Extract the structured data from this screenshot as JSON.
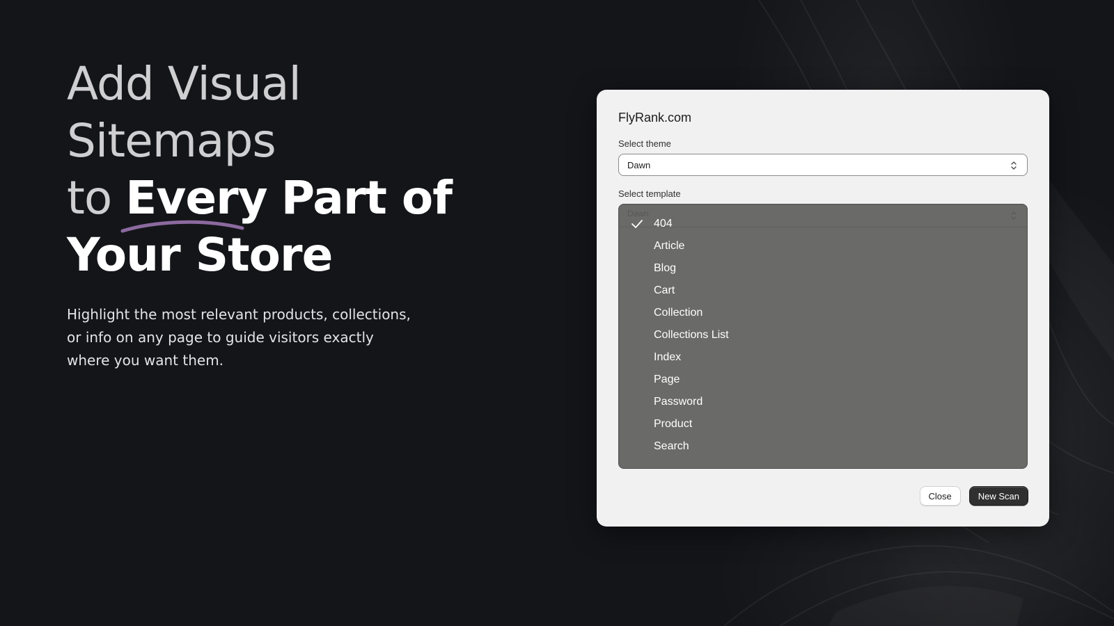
{
  "hero": {
    "headline_line1": "Add Visual Sitemaps",
    "headline_line2_prefix": "to",
    "headline_line2_emphasis": "Every",
    "headline_line2_suffix": "Part of",
    "headline_line3": "Your Store",
    "subtext": "Highlight the most relevant products, collections, or info on any page to guide visitors exactly where you want them.",
    "underline_color": "#8b6a9f"
  },
  "dialog": {
    "title": "FlyRank.com",
    "theme_label": "Select theme",
    "theme_value": "Dawn",
    "template_label": "Select template",
    "template_ghost_value": "Dawn",
    "template_options": [
      {
        "label": "404",
        "selected": true
      },
      {
        "label": "Article",
        "selected": false
      },
      {
        "label": "Blog",
        "selected": false
      },
      {
        "label": "Cart",
        "selected": false
      },
      {
        "label": "Collection",
        "selected": false
      },
      {
        "label": "Collections List",
        "selected": false
      },
      {
        "label": "Index",
        "selected": false
      },
      {
        "label": "Page",
        "selected": false
      },
      {
        "label": "Password",
        "selected": false
      },
      {
        "label": "Product",
        "selected": false
      },
      {
        "label": "Search",
        "selected": false
      }
    ],
    "close_label": "Close",
    "new_scan_label": "New Scan"
  },
  "icons": {
    "select_chevron": "chevron-up-down-icon",
    "selected_check": "checkmark-icon"
  },
  "colors": {
    "page_background": "#141519",
    "dropdown_background": "#6a6a69",
    "primary_button": "#303030"
  }
}
